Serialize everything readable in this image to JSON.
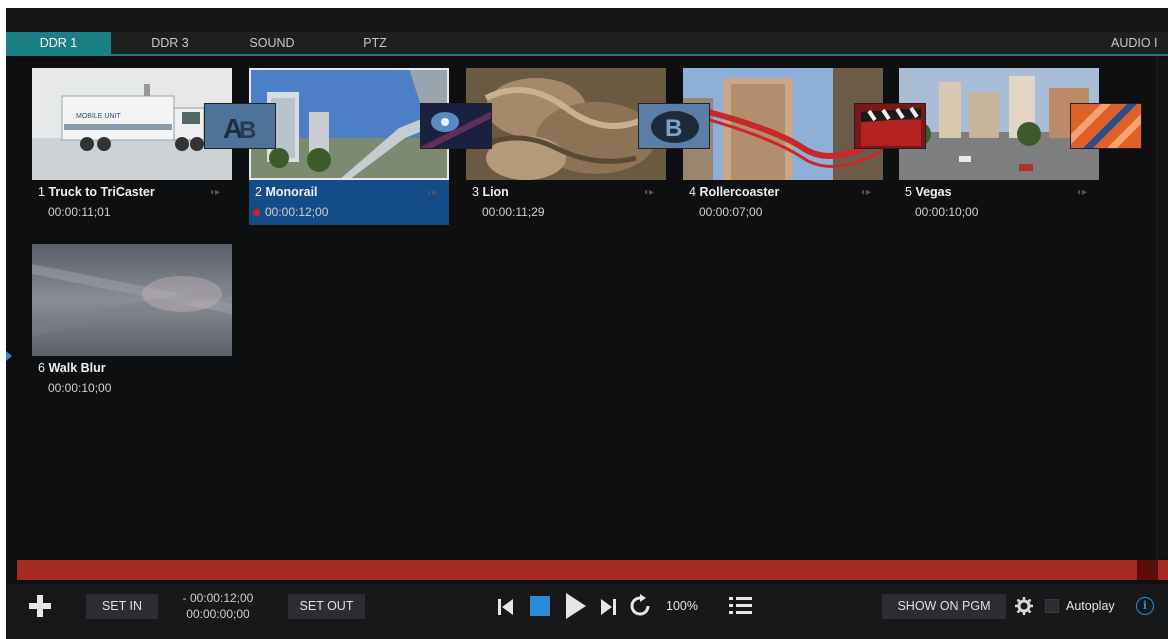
{
  "tabs": [
    {
      "label": "DDR 1",
      "active": true
    },
    {
      "label": "DDR 3",
      "active": false
    },
    {
      "label": "SOUND",
      "active": false
    },
    {
      "label": "PTZ",
      "active": false
    }
  ],
  "audio_tab_label": "AUDIO I",
  "clips": [
    {
      "number": "1",
      "name": "Truck to TriCaster",
      "duration": "00:00:11;01",
      "selected": false
    },
    {
      "number": "2",
      "name": "Monorail",
      "duration": "00:00:12;00",
      "selected": true
    },
    {
      "number": "3",
      "name": "Lion",
      "duration": "00:00:11;29",
      "selected": false
    },
    {
      "number": "4",
      "name": "Rollercoaster",
      "duration": "00:00:07;00",
      "selected": false
    },
    {
      "number": "5",
      "name": "Vegas",
      "duration": "00:00:10;00",
      "selected": false
    },
    {
      "number": "6",
      "name": "Walk Blur",
      "duration": "00:00:10;00",
      "selected": false
    }
  ],
  "controls": {
    "add_icon": "plus-icon",
    "set_in_label": "SET IN",
    "remaining_time": "- 00:00:12;00",
    "elapsed_time": "00:00:00;00",
    "set_out_label": "SET OUT",
    "speed": "100%",
    "show_on_pgm_label": "SHOW ON PGM",
    "autoplay_label": "Autoplay",
    "info_glyph": "i"
  },
  "colors": {
    "accent_teal": "#1a7f86",
    "selection_blue": "#124d8a",
    "timeline_red": "#a52b22",
    "stop_blue": "#2b8cd6",
    "record_red": "#e02020"
  }
}
